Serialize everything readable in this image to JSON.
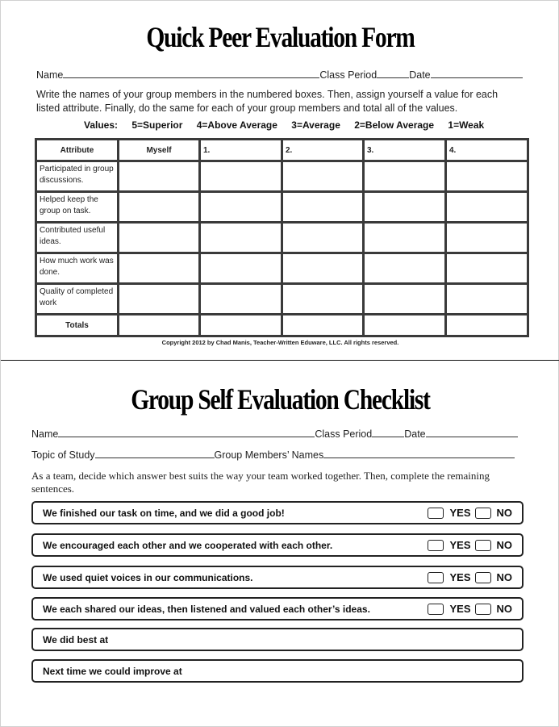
{
  "peer_form": {
    "title": "Quick Peer Evaluation Form",
    "name_label": "Name",
    "class_period_label": "Class Period",
    "date_label": "Date",
    "instructions": "Write the names of your group members in the numbered boxes.  Then,  assign yourself a value for each listed attribute.  Finally, do the same for each of your group members and total all of the values.",
    "values_label": "Values:",
    "values": [
      "5=Superior",
      "4=Above Average",
      "3=Average",
      "2=Below Average",
      "1=Weak"
    ],
    "table": {
      "headers": [
        "Attribute",
        "Myself",
        "1.",
        "2.",
        "3.",
        "4."
      ],
      "rows": [
        "Participated in group discussions.",
        "Helped keep the group on task.",
        "Contributed useful ideas.",
        "How much work was done.",
        "Quality of completed work"
      ],
      "totals_label": "Totals"
    },
    "copyright": "Copyright 2012 by Chad Manis, Teacher-Written Eduware, LLC.  All rights reserved."
  },
  "group_checklist": {
    "title": "Group Self Evaluation Checklist",
    "name_label": "Name",
    "class_period_label": "Class Period",
    "date_label": "Date",
    "topic_label": "Topic of Study",
    "members_label": "Group Members’ Names",
    "instructions": "As a team, decide which answer best suits the way your team worked together.  Then, complete the remaining sentences.",
    "yes_label": "YES",
    "no_label": "NO",
    "items": [
      "We finished our task on time, and we did a good job!",
      "We encouraged each other and we cooperated with each other.",
      "We used quiet voices in our communications.",
      "We each shared our ideas, then listened and valued each other’s ideas."
    ],
    "sentences": [
      "We did best at",
      "Next time we could improve at"
    ]
  }
}
